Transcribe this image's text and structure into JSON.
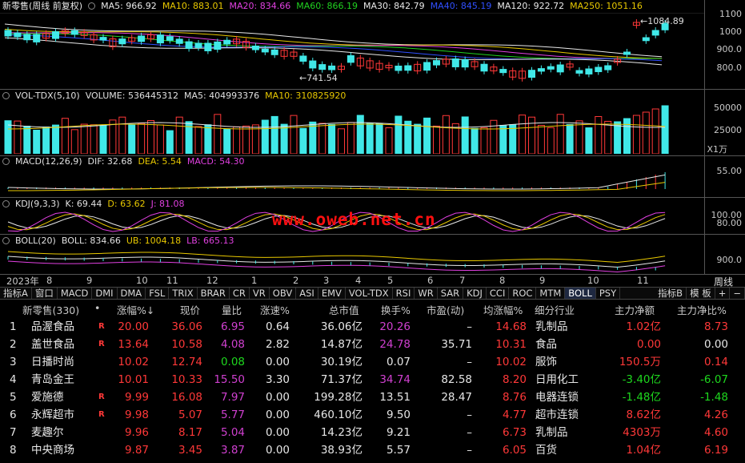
{
  "main_header": {
    "name": "新零售(周线 前复权)",
    "items": [
      {
        "label": "MA5: 966.92",
        "color": "#e8e8e8"
      },
      {
        "label": "MA10: 883.01",
        "color": "#e8c800"
      },
      {
        "label": "MA20: 834.66",
        "color": "#e040e0"
      },
      {
        "label": "MA60: 866.19",
        "color": "#20d020"
      },
      {
        "label": "MA30: 842.79",
        "color": "#e8e8e8"
      },
      {
        "label": "MA40: 845.19",
        "color": "#3050ff"
      },
      {
        "label": "MA120: 922.72",
        "color": "#e8e8e8"
      },
      {
        "label": "MA250: 1051.16",
        "color": "#e8c800"
      }
    ],
    "high_label": "1084.89",
    "low_label": "741.54",
    "yticks": [
      "1100",
      "1000",
      "900.0",
      "800.0"
    ]
  },
  "vol_header": {
    "items": [
      {
        "label": "VOL-TDX(5,10)",
        "color": "#e0e0e0"
      },
      {
        "label": "VOLUME: 536445312",
        "color": "#e0e0e0"
      },
      {
        "label": "MA5: 404993376",
        "color": "#e0e0e0"
      },
      {
        "label": "MA10: 310825920",
        "color": "#e8c800"
      }
    ],
    "yticks": [
      "50000",
      "25000"
    ],
    "unit": "X1万"
  },
  "macd_header": {
    "items": [
      {
        "label": "MACD(12,26,9)",
        "color": "#e0e0e0"
      },
      {
        "label": "DIF: 32.68",
        "color": "#e0e0e0"
      },
      {
        "label": "DEA: 5.54",
        "color": "#e8c800"
      },
      {
        "label": "MACD: 54.30",
        "color": "#e040e0"
      }
    ],
    "yticks": [
      "55.00"
    ]
  },
  "kdj_header": {
    "items": [
      {
        "label": "KDJ(9,3,3)",
        "color": "#e0e0e0"
      },
      {
        "label": "K: 69.44",
        "color": "#e0e0e0"
      },
      {
        "label": "D: 63.62",
        "color": "#e8c800"
      },
      {
        "label": "J: 81.08",
        "color": "#e040e0"
      }
    ],
    "yticks": [
      "100.00",
      "80.00"
    ]
  },
  "boll_header": {
    "items": [
      {
        "label": "BOLL(20)",
        "color": "#e0e0e0"
      },
      {
        "label": "BOLL: 834.66",
        "color": "#e0e0e0"
      },
      {
        "label": "UB: 1004.18",
        "color": "#e8c800"
      },
      {
        "label": "LB: 665.13",
        "color": "#e040e0"
      }
    ],
    "yticks": [
      "900.0"
    ]
  },
  "watermark": "www.oweb.net.cn",
  "time_axis": [
    "2023年",
    "8",
    "9",
    "10",
    "11",
    "12",
    "1",
    "2",
    "3",
    "4",
    "5",
    "6",
    "7",
    "8",
    "9",
    "10",
    "11"
  ],
  "period_label": "周线",
  "tabs": [
    "指标A",
    "窗口",
    "MACD",
    "DMI",
    "DMA",
    "FSL",
    "TRIX",
    "BRAR",
    "CR",
    "VR",
    "OBV",
    "ASI",
    "EMV",
    "VOL-TDX",
    "RSI",
    "WR",
    "SAR",
    "KDJ",
    "CCI",
    "ROC",
    "MTM",
    "BOLL",
    "PSY"
  ],
  "tabs_right": [
    "指标B",
    "模 板",
    "+",
    "−"
  ],
  "active_tab": "BOLL",
  "table": {
    "headers": [
      "新零售(330)",
      "•",
      "涨幅%↓",
      "现价",
      "量比",
      "涨速%",
      "总市值",
      "换手%",
      "市盈(动)",
      "均涨幅%",
      "细分行业",
      "主力净额",
      "主力净比%"
    ],
    "rows": [
      {
        "no": "1",
        "name": "品渥食品",
        "flag": "R",
        "chg": "20.00",
        "price": "36.06",
        "vr": "6.95",
        "spd": "0.64",
        "cap": "36.06亿",
        "turn": "20.26",
        "pe": "–",
        "avg": "14.68",
        "ind": "乳制品",
        "net": "1.02亿",
        "ratio": "8.73"
      },
      {
        "no": "2",
        "name": "盖世食品",
        "flag": "R",
        "chg": "13.64",
        "price": "10.58",
        "vr": "4.08",
        "spd": "2.82",
        "cap": "14.87亿",
        "turn": "24.78",
        "pe": "35.71",
        "avg": "10.31",
        "ind": "食品",
        "net": "0.00",
        "ratio": "0.00"
      },
      {
        "no": "3",
        "name": "日播时尚",
        "flag": "",
        "chg": "10.02",
        "price": "12.74",
        "vr": "0.08",
        "spd": "0.00",
        "cap": "30.19亿",
        "turn": "0.07",
        "pe": "–",
        "avg": "10.02",
        "ind": "服饰",
        "net": "150.5万",
        "ratio": "0.14"
      },
      {
        "no": "4",
        "name": "青岛金王",
        "flag": "",
        "chg": "10.01",
        "price": "10.33",
        "vr": "15.50",
        "spd": "3.30",
        "cap": "71.37亿",
        "turn": "34.74",
        "pe": "82.58",
        "avg": "8.20",
        "ind": "日用化工",
        "net": "-3.40亿",
        "ratio": "-6.07"
      },
      {
        "no": "5",
        "name": "爱施德",
        "flag": "R",
        "chg": "9.99",
        "price": "16.08",
        "vr": "7.97",
        "spd": "0.00",
        "cap": "199.28亿",
        "turn": "13.51",
        "pe": "28.47",
        "avg": "8.76",
        "ind": "电器连锁",
        "net": "-1.48亿",
        "ratio": "-1.48"
      },
      {
        "no": "6",
        "name": "永辉超市",
        "flag": "R",
        "chg": "9.98",
        "price": "5.07",
        "vr": "5.77",
        "spd": "0.00",
        "cap": "460.10亿",
        "turn": "9.50",
        "pe": "–",
        "avg": "4.77",
        "ind": "超市连锁",
        "net": "8.62亿",
        "ratio": "4.26"
      },
      {
        "no": "7",
        "name": "麦趣尔",
        "flag": "",
        "chg": "9.96",
        "price": "8.17",
        "vr": "5.04",
        "spd": "0.00",
        "cap": "14.23亿",
        "turn": "9.21",
        "pe": "–",
        "avg": "6.73",
        "ind": "乳制品",
        "net": "4303万",
        "ratio": "4.60"
      },
      {
        "no": "8",
        "name": "中央商场",
        "flag": "",
        "chg": "9.87",
        "price": "3.45",
        "vr": "3.87",
        "spd": "0.00",
        "cap": "38.93亿",
        "turn": "5.57",
        "pe": "–",
        "avg": "6.05",
        "ind": "百货",
        "net": "1.04亿",
        "ratio": "6.19"
      }
    ]
  }
}
